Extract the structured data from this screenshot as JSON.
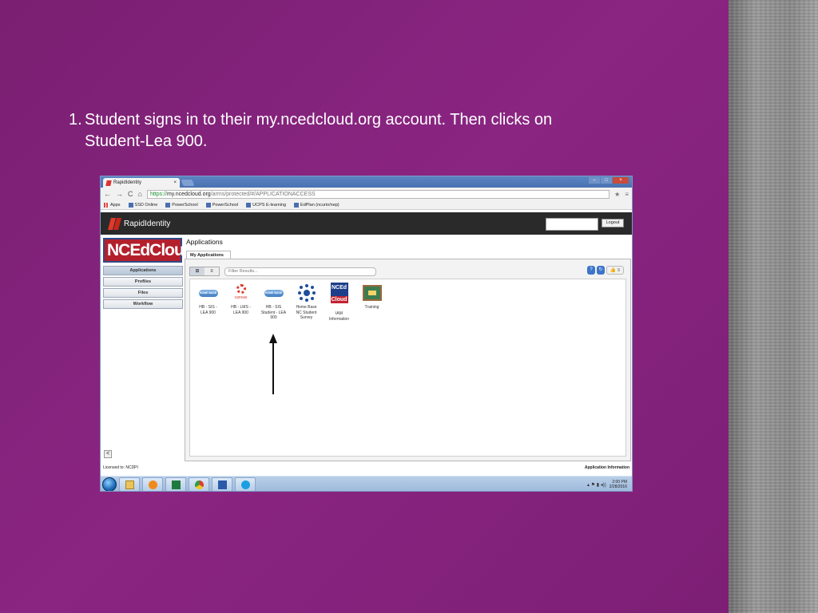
{
  "slide": {
    "step_number": "1.",
    "line1": "Student signs in to their my.ncedcloud.org account. Then clicks on",
    "line2": "Student-Lea 900."
  },
  "browser": {
    "tab_title": "RapidIdentity",
    "tab_close": "×",
    "window_controls": [
      "–",
      "□",
      "×"
    ],
    "url_scheme": "https://",
    "url_host": "my.ncedcloud.org",
    "url_path": "/arms/protected/#/APPLICATIONACCESS",
    "nav_icons": [
      "←",
      "→",
      "C",
      "⌂"
    ],
    "bookmarks": [
      "Apps",
      "SSD Online",
      "PowerSchool",
      "PowerSchool",
      "UCPS E-learning",
      "EdPlan (ncurio/nep)"
    ]
  },
  "rapididentity": {
    "brand": "RapidIdentity",
    "logout_label": "Logout"
  },
  "sidebar": {
    "logo_text_a": "NCEd",
    "logo_text_b": "Cloud",
    "items": [
      {
        "label": "Applications",
        "active": true
      },
      {
        "label": "Profiles"
      },
      {
        "label": "Files"
      },
      {
        "label": "Workflow"
      }
    ],
    "collapse_label": "<"
  },
  "main": {
    "title": "Applications",
    "tab_label": "My Applications",
    "filter_placeholder": "Filter Results...",
    "view_toggle": [
      "⊞",
      "≡"
    ],
    "right_buttons": [
      "?",
      "↻",
      "👍 ≡"
    ],
    "apps": [
      {
        "line1": "HB - SIS -",
        "line2": "LEA 900",
        "line3": "",
        "icon": "home-base-icon",
        "badge": "HOME BASE"
      },
      {
        "line1": "HB - LMS -",
        "line2": "LEA 900",
        "line3": "",
        "icon": "canvas-icon",
        "badge": "canvas"
      },
      {
        "line1": "HB - SIS",
        "line2": "Student - LEA",
        "line3": "900",
        "icon": "home-base-icon",
        "badge": "HOME BASE"
      },
      {
        "line1": "Home Base",
        "line2": "NC Student",
        "line3": "Survey",
        "icon": "survey-icon",
        "badge": ""
      },
      {
        "line1": "IAM",
        "line2": "Information",
        "line3": "",
        "icon": "ncedcloud-icon",
        "badge": "NCEd"
      },
      {
        "line1": "Training",
        "line2": "",
        "line3": "",
        "icon": "training-icon",
        "badge": ""
      }
    ],
    "ncedcloud_icon_cloud": "Cloud"
  },
  "status": {
    "licensed": "Licensed to: NCDPI",
    "app_info": "Application Information"
  },
  "taskbar": {
    "apps": [
      "explorer-icon",
      "media-player-icon",
      "excel-icon",
      "chrome-icon",
      "word-icon",
      "skype-icon"
    ],
    "time": "2:00 PM",
    "date": "2/28/2016"
  },
  "colors": {
    "slide_bg": "#82207a",
    "brand_red": "#e03a2c",
    "nced_blue": "#1d3f8a"
  }
}
